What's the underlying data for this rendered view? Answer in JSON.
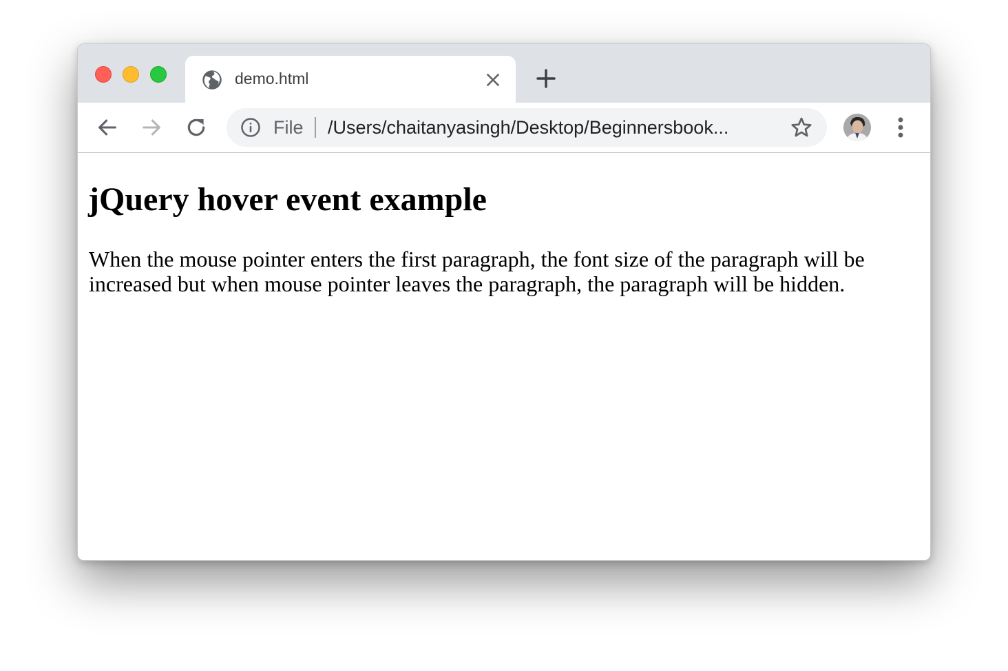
{
  "browser": {
    "tab": {
      "title": "demo.html",
      "favicon": "globe-icon",
      "close_icon": "close-icon"
    },
    "new_tab_icon": "plus-icon",
    "nav": {
      "back_icon": "arrow-left-icon",
      "forward_icon": "arrow-right-icon",
      "reload_icon": "reload-icon"
    },
    "omnibox": {
      "info_icon": "info-icon",
      "scheme": "File",
      "url": "/Users/chaitanyasingh/Desktop/Beginnersbook...",
      "bookmark_icon": "star-icon"
    },
    "profile_icon": "avatar",
    "menu_icon": "kebab-menu-icon"
  },
  "page": {
    "heading": "jQuery hover event example",
    "paragraph": "When the mouse pointer enters the first paragraph, the font size of the paragraph will be increased but when mouse pointer leaves the paragraph, the paragraph will be hidden."
  },
  "colors": {
    "tabstrip_bg": "#dee1e6",
    "omnibox_bg": "#f1f3f4",
    "traffic_close": "#fe5f57",
    "traffic_minimize": "#febc2e",
    "traffic_maximize": "#28c840"
  }
}
